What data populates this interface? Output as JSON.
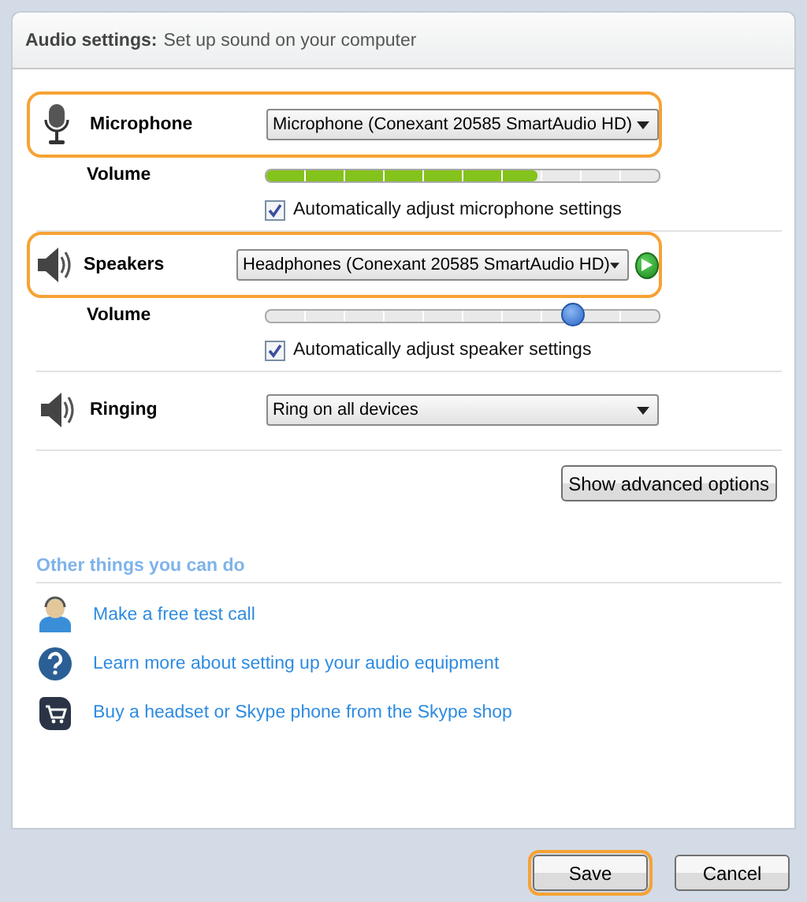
{
  "header": {
    "title": "Audio settings:",
    "subtitle": "Set up sound on your computer"
  },
  "devices": [
    {
      "kind": "microphone",
      "label": "Microphone",
      "highlighted": true,
      "device": "Microphone (Conexant 20585 SmartAudio HD)",
      "play_button": false,
      "volume": {
        "label": "Volume",
        "kind": "meter",
        "level": 0.69
      },
      "auto_adjust": {
        "label": "Automatically adjust microphone settings",
        "checked": true
      }
    },
    {
      "kind": "speakers",
      "label": "Speakers",
      "highlighted": true,
      "device": "Headphones (Conexant 20585 SmartAudio HD)",
      "play_button": true,
      "volume": {
        "label": "Volume",
        "kind": "slider",
        "level": 0.78
      },
      "auto_adjust": {
        "label": "Automatically adjust speaker settings",
        "checked": true
      }
    },
    {
      "kind": "ringing",
      "label": "Ringing",
      "highlighted": false,
      "device": "Ring on all devices",
      "play_button": false
    }
  ],
  "advanced_button": "Show advanced options",
  "other": {
    "heading": "Other things you can do",
    "links": [
      {
        "kind": "call",
        "text": "Make a free test call"
      },
      {
        "kind": "help",
        "text": "Learn more about setting up your audio equipment"
      },
      {
        "kind": "shop",
        "text": "Buy a headset or Skype phone from the Skype shop"
      }
    ]
  },
  "buttons": [
    {
      "label": "Save",
      "highlighted": true
    },
    {
      "label": "Cancel",
      "highlighted": false
    }
  ]
}
